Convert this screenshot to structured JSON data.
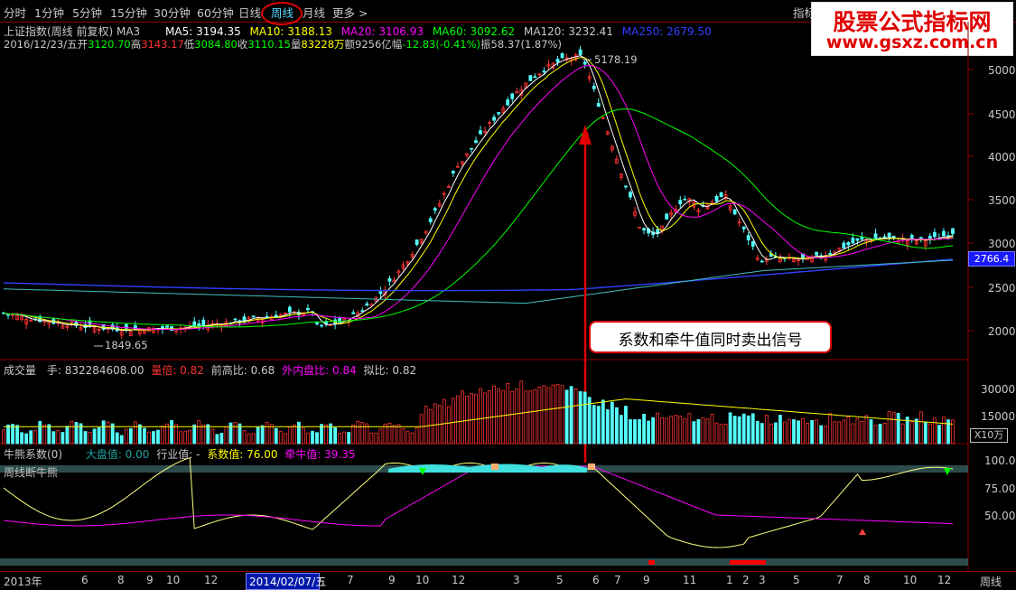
{
  "tabs": [
    "分时",
    "1分钟",
    "5分钟",
    "15分钟",
    "30分钟",
    "60分钟",
    "日线",
    "周线",
    "月线",
    "更多 >"
  ],
  "active_tab": "周线",
  "corner_label": "指标",
  "logo": {
    "title": "股票公式指标网",
    "url": "www.gsxz.com.cn"
  },
  "price_header": {
    "title": "上证指数(周线 前复权) MA3",
    "ma5": "MA5: 3194.35",
    "ma10": "MA10: 3188.13",
    "ma20": "MA20: 3106.93",
    "ma60": "MA60: 3092.62",
    "ma120": "MA120: 3232.41",
    "ma250": "MA250: 2679.50"
  },
  "bar_info": {
    "date": "2016/12/23/五",
    "open_label": "开",
    "open": "3120.70",
    "high_label": "高",
    "high": "3143.17",
    "low_label": "低",
    "low": "3084.80",
    "close_label": "收",
    "close": "3110.15",
    "volume_label": "量",
    "volume": "83228万",
    "amount_label": "额",
    "amount": "9256亿",
    "change_label": "幅",
    "change": "-12.83(-0.41%)",
    "amplitude_label": "振",
    "amplitude": "58.37(1.87%)"
  },
  "peak_label": "5178.19",
  "trough_label": "1849.65",
  "price_axis": [
    "5000",
    "4500",
    "4000",
    "3500",
    "3000",
    "2500",
    "2000"
  ],
  "last_price_tag": "2766.4",
  "volume_header": {
    "title": "成交量",
    "hand": "手: 832284608.00",
    "liang_bei": "量倍: 0.82",
    "qian_gao_bi": "前高比: 0.68",
    "wai_nei": "外内盘比: 0.84",
    "ni_bi": "拟比: 0.82"
  },
  "volume_axis": [
    "30000",
    "15000"
  ],
  "volume_unit": "X10万",
  "indicator_header": {
    "title": "牛熊系数(0)",
    "da_pan": "大盘值: 0.00",
    "hang_ye": "行业值: -",
    "xi_shu": "系数值: 76.00",
    "qian_niu": "牵牛值: 39.35"
  },
  "indicator_sub": "周线断牛熊",
  "indicator_axis": [
    "100.0",
    "75.00",
    "50.00"
  ],
  "signal_annotation": "系数和牵牛值同时卖出信号",
  "x_axis_labels": [
    "2013年",
    "6",
    "8",
    "9",
    "10",
    "12",
    "2014/02/07/五",
    "7",
    "9",
    "10",
    "12",
    "3",
    "5",
    "6",
    "7",
    "9",
    "11",
    "1",
    "2",
    "3",
    "5",
    "7",
    "8",
    "10",
    "12"
  ],
  "period_label": "周线",
  "colors": {
    "up": "#ff3232",
    "down": "#54ffff",
    "ma5": "#ffffff",
    "ma10": "#ffff00",
    "ma20": "#ff00ff",
    "ma60": "#00ff00",
    "ma250": "#3040ff",
    "accent_red": "#e00000"
  }
}
